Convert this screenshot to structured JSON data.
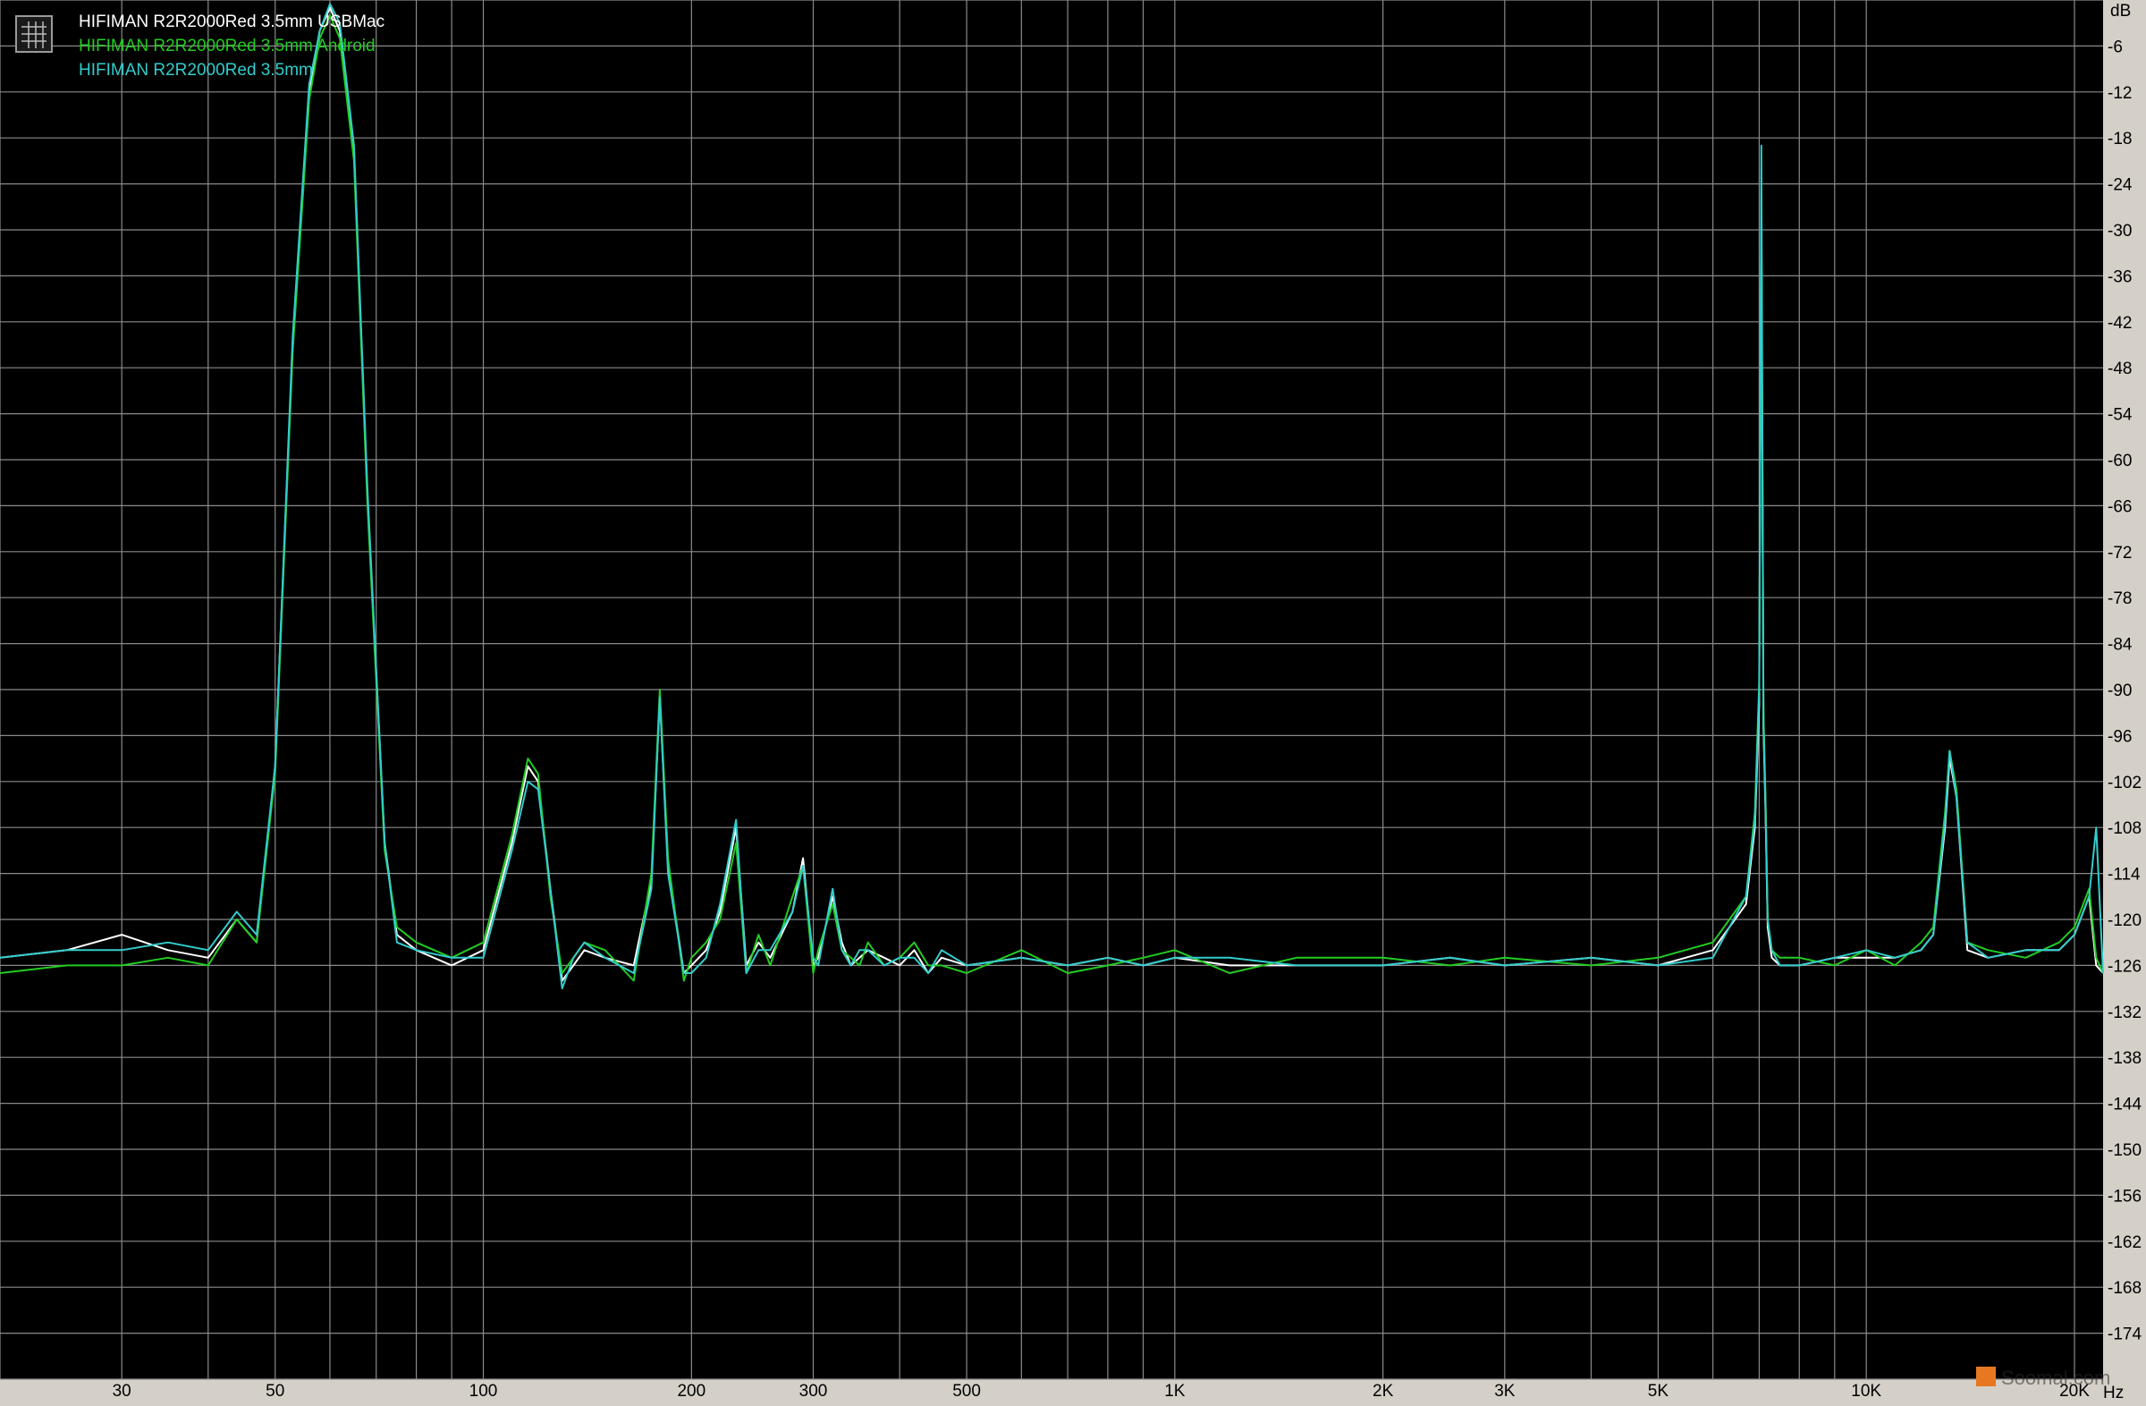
{
  "chart_data": {
    "type": "line",
    "title": "",
    "xlabel": "Hz",
    "ylabel": "dB",
    "x_scale": "log",
    "xlim": [
      20,
      22000
    ],
    "ylim": [
      -180,
      0
    ],
    "grid": true,
    "legend_position": "top-left",
    "x_ticks": [
      {
        "value": 30,
        "label": "30"
      },
      {
        "value": 50,
        "label": "50"
      },
      {
        "value": 100,
        "label": "100"
      },
      {
        "value": 200,
        "label": "200"
      },
      {
        "value": 300,
        "label": "300"
      },
      {
        "value": 500,
        "label": "500"
      },
      {
        "value": 1000,
        "label": "1K"
      },
      {
        "value": 2000,
        "label": "2K"
      },
      {
        "value": 3000,
        "label": "3K"
      },
      {
        "value": 5000,
        "label": "5K"
      },
      {
        "value": 10000,
        "label": "10K"
      },
      {
        "value": 20000,
        "label": "20K"
      }
    ],
    "y_ticks": [
      {
        "value": -6,
        "label": "-6"
      },
      {
        "value": -12,
        "label": "-12"
      },
      {
        "value": -18,
        "label": "-18"
      },
      {
        "value": -24,
        "label": "-24"
      },
      {
        "value": -30,
        "label": "-30"
      },
      {
        "value": -36,
        "label": "-36"
      },
      {
        "value": -42,
        "label": "-42"
      },
      {
        "value": -48,
        "label": "-48"
      },
      {
        "value": -54,
        "label": "-54"
      },
      {
        "value": -60,
        "label": "-60"
      },
      {
        "value": -66,
        "label": "-66"
      },
      {
        "value": -72,
        "label": "-72"
      },
      {
        "value": -78,
        "label": "-78"
      },
      {
        "value": -84,
        "label": "-84"
      },
      {
        "value": -90,
        "label": "-90"
      },
      {
        "value": -96,
        "label": "-96"
      },
      {
        "value": -102,
        "label": "-102"
      },
      {
        "value": -108,
        "label": "-108"
      },
      {
        "value": -114,
        "label": "-114"
      },
      {
        "value": -120,
        "label": "-120"
      },
      {
        "value": -126,
        "label": "-126"
      },
      {
        "value": -132,
        "label": "-132"
      },
      {
        "value": -138,
        "label": "-138"
      },
      {
        "value": -144,
        "label": "-144"
      },
      {
        "value": -150,
        "label": "-150"
      },
      {
        "value": -156,
        "label": "-156"
      },
      {
        "value": -162,
        "label": "-162"
      },
      {
        "value": -168,
        "label": "-168"
      },
      {
        "value": -174,
        "label": "-174"
      }
    ],
    "series": [
      {
        "name": "HIFIMAN R2R2000Red 3.5mm USBMac",
        "color": "#ffffff",
        "x": [
          20,
          25,
          30,
          35,
          40,
          44,
          47,
          50,
          53,
          56,
          58,
          60,
          62,
          65,
          68,
          72,
          75,
          80,
          90,
          100,
          110,
          116,
          120,
          125,
          130,
          135,
          140,
          150,
          165,
          175,
          180,
          185,
          195,
          200,
          210,
          220,
          232,
          240,
          250,
          260,
          280,
          290,
          300,
          305,
          320,
          330,
          340,
          350,
          360,
          380,
          400,
          420,
          440,
          460,
          500,
          600,
          700,
          800,
          900,
          1000,
          1200,
          1500,
          2000,
          2500,
          3000,
          4000,
          5000,
          6000,
          6700,
          6900,
          7000,
          7050,
          7100,
          7150,
          7200,
          7300,
          7500,
          8000,
          9000,
          10000,
          11000,
          12000,
          12500,
          13000,
          13200,
          13500,
          14000,
          15000,
          17000,
          19000,
          20000,
          21000,
          21500,
          22000
        ],
        "y": [
          -125,
          -124,
          -122,
          -124,
          -125,
          -120,
          -123,
          -100,
          -45,
          -12,
          -4,
          -1,
          -4,
          -20,
          -65,
          -110,
          -122,
          -124,
          -126,
          -124,
          -110,
          -100,
          -102,
          -116,
          -128,
          -126,
          -124,
          -125,
          -126,
          -115,
          -91,
          -113,
          -127,
          -126,
          -124,
          -119,
          -108,
          -126,
          -123,
          -125,
          -119,
          -112,
          -126,
          -125,
          -117,
          -123,
          -126,
          -125,
          -124,
          -125,
          -126,
          -124,
          -127,
          -125,
          -126,
          -125,
          -126,
          -125,
          -126,
          -125,
          -126,
          -126,
          -126,
          -125,
          -126,
          -125,
          -126,
          -124,
          -118,
          -108,
          -92,
          -26,
          -95,
          -106,
          -121,
          -125,
          -126,
          -126,
          -125,
          -125,
          -125,
          -124,
          -122,
          -108,
          -99,
          -104,
          -124,
          -125,
          -124,
          -124,
          -122,
          -117,
          -126,
          -127
        ]
      },
      {
        "name": "HIFIMAN R2R2000Red 3.5mm Android",
        "color": "#22cc22",
        "x": [
          20,
          25,
          30,
          35,
          40,
          44,
          47,
          50,
          53,
          56,
          58,
          60,
          62,
          65,
          68,
          72,
          75,
          80,
          90,
          100,
          110,
          116,
          120,
          125,
          130,
          135,
          140,
          150,
          165,
          175,
          180,
          185,
          195,
          200,
          210,
          220,
          232,
          240,
          250,
          260,
          280,
          290,
          300,
          305,
          320,
          330,
          340,
          350,
          360,
          380,
          400,
          420,
          440,
          460,
          500,
          600,
          700,
          800,
          900,
          1000,
          1200,
          1500,
          2000,
          2500,
          3000,
          4000,
          5000,
          6000,
          6700,
          6900,
          7000,
          7050,
          7100,
          7150,
          7200,
          7300,
          7500,
          8000,
          9000,
          10000,
          11000,
          12000,
          12500,
          13000,
          13200,
          13500,
          14000,
          15000,
          17000,
          19000,
          20000,
          21000,
          21500,
          22000
        ],
        "y": [
          -127,
          -126,
          -126,
          -125,
          -126,
          -120,
          -123,
          -101,
          -46,
          -13,
          -5,
          -2,
          -5,
          -21,
          -66,
          -111,
          -121,
          -123,
          -125,
          -123,
          -109,
          -99,
          -101,
          -117,
          -127,
          -125,
          -123,
          -124,
          -128,
          -114,
          -90,
          -112,
          -128,
          -125,
          -123,
          -120,
          -110,
          -127,
          -122,
          -126,
          -117,
          -113,
          -127,
          -124,
          -118,
          -124,
          -125,
          -126,
          -123,
          -126,
          -125,
          -123,
          -126,
          -126,
          -127,
          -124,
          -127,
          -126,
          -125,
          -124,
          -127,
          -125,
          -125,
          -126,
          -125,
          -126,
          -125,
          -123,
          -117,
          -106,
          -89,
          -28,
          -93,
          -104,
          -120,
          -124,
          -125,
          -125,
          -126,
          -124,
          -126,
          -123,
          -121,
          -106,
          -98,
          -103,
          -123,
          -124,
          -125,
          -123,
          -121,
          -116,
          -125,
          -127
        ]
      },
      {
        "name": "HIFIMAN R2R2000Red 3.5mm",
        "color": "#33cccc",
        "x": [
          20,
          25,
          30,
          35,
          40,
          44,
          47,
          50,
          53,
          56,
          58,
          60,
          62,
          65,
          68,
          72,
          75,
          80,
          90,
          100,
          110,
          116,
          120,
          125,
          130,
          135,
          140,
          150,
          165,
          175,
          180,
          185,
          195,
          200,
          210,
          220,
          232,
          240,
          250,
          260,
          280,
          290,
          300,
          305,
          320,
          330,
          340,
          350,
          360,
          380,
          400,
          420,
          440,
          460,
          500,
          600,
          700,
          800,
          900,
          1000,
          1200,
          1500,
          2000,
          2500,
          3000,
          4000,
          5000,
          6000,
          6700,
          6900,
          7000,
          7050,
          7100,
          7150,
          7200,
          7300,
          7500,
          8000,
          9000,
          10000,
          11000,
          12000,
          12500,
          13000,
          13200,
          13500,
          14000,
          15000,
          17000,
          19000,
          20000,
          21000,
          21500,
          22000
        ],
        "y": [
          -125,
          -124,
          -124,
          -123,
          -124,
          -119,
          -122,
          -100,
          -44,
          -11,
          -4,
          -0.5,
          -3,
          -19,
          -64,
          -110,
          -123,
          -124,
          -125,
          -125,
          -111,
          -102,
          -103,
          -116,
          -129,
          -125,
          -123,
          -125,
          -127,
          -116,
          -91,
          -114,
          -127,
          -127,
          -125,
          -118,
          -107,
          -127,
          -124,
          -124,
          -119,
          -113,
          -125,
          -126,
          -116,
          -124,
          -126,
          -124,
          -124,
          -126,
          -125,
          -125,
          -127,
          -124,
          -126,
          -125,
          -126,
          -125,
          -126,
          -125,
          -125,
          -126,
          -126,
          -125,
          -126,
          -125,
          -126,
          -125,
          -117,
          -107,
          -90,
          -19,
          -94,
          -105,
          -120,
          -124,
          -126,
          -126,
          -125,
          -124,
          -125,
          -124,
          -122,
          -107,
          -98,
          -104,
          -123,
          -125,
          -124,
          -124,
          -122,
          -117,
          -108,
          -127
        ]
      }
    ]
  },
  "watermark": {
    "text": "Soomal.com"
  }
}
